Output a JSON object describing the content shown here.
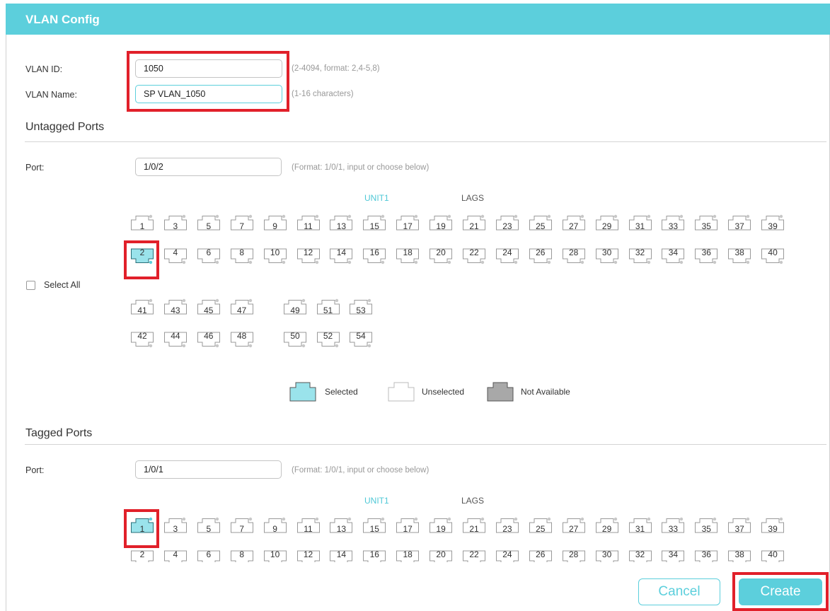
{
  "title": "VLAN Config",
  "vlan_id": {
    "label": "VLAN ID:",
    "value": "1050",
    "hint": "(2-4094, format: 2,4-5,8)"
  },
  "vlan_name": {
    "label": "VLAN Name:",
    "value": "SP VLAN_1050",
    "hint": "(1-16 characters)"
  },
  "untagged": {
    "heading": "Untagged Ports",
    "port_label": "Port:",
    "port_value": "1/0/2",
    "port_hint": "(Format: 1/0/1, input or choose below)",
    "unit_tab": "UNIT1",
    "lags_tab": "LAGS",
    "select_all": "Select All",
    "selected_ports": [
      "2"
    ]
  },
  "tagged": {
    "heading": "Tagged Ports",
    "port_label": "Port:",
    "port_value": "1/0/1",
    "port_hint": "(Format: 1/0/1, input or choose below)",
    "unit_tab": "UNIT1",
    "lags_tab": "LAGS",
    "selected_ports": [
      "1"
    ]
  },
  "legend": {
    "selected": "Selected",
    "unselected": "Unselected",
    "not_available": "Not Available"
  },
  "ports": {
    "row_top": [
      "1",
      "3",
      "5",
      "7",
      "9",
      "11",
      "13",
      "15",
      "17",
      "19",
      "21",
      "23",
      "25",
      "27",
      "29",
      "31",
      "33",
      "35",
      "37",
      "39"
    ],
    "row_bottom": [
      "2",
      "4",
      "6",
      "8",
      "10",
      "12",
      "14",
      "16",
      "18",
      "20",
      "22",
      "24",
      "26",
      "28",
      "30",
      "32",
      "34",
      "36",
      "38",
      "40"
    ],
    "sfp_top_a": [
      "41",
      "43",
      "45",
      "47"
    ],
    "sfp_top_b": [
      "49",
      "51",
      "53"
    ],
    "sfp_bottom_a": [
      "42",
      "44",
      "46",
      "48"
    ],
    "sfp_bottom_b": [
      "50",
      "52",
      "54"
    ]
  },
  "colors": {
    "accent": "#5ccfdc",
    "highlight": "#e1202a",
    "selected_fill": "#9ae3eb",
    "not_available_fill": "#a8a8a8"
  },
  "buttons": {
    "cancel": "Cancel",
    "create": "Create"
  }
}
